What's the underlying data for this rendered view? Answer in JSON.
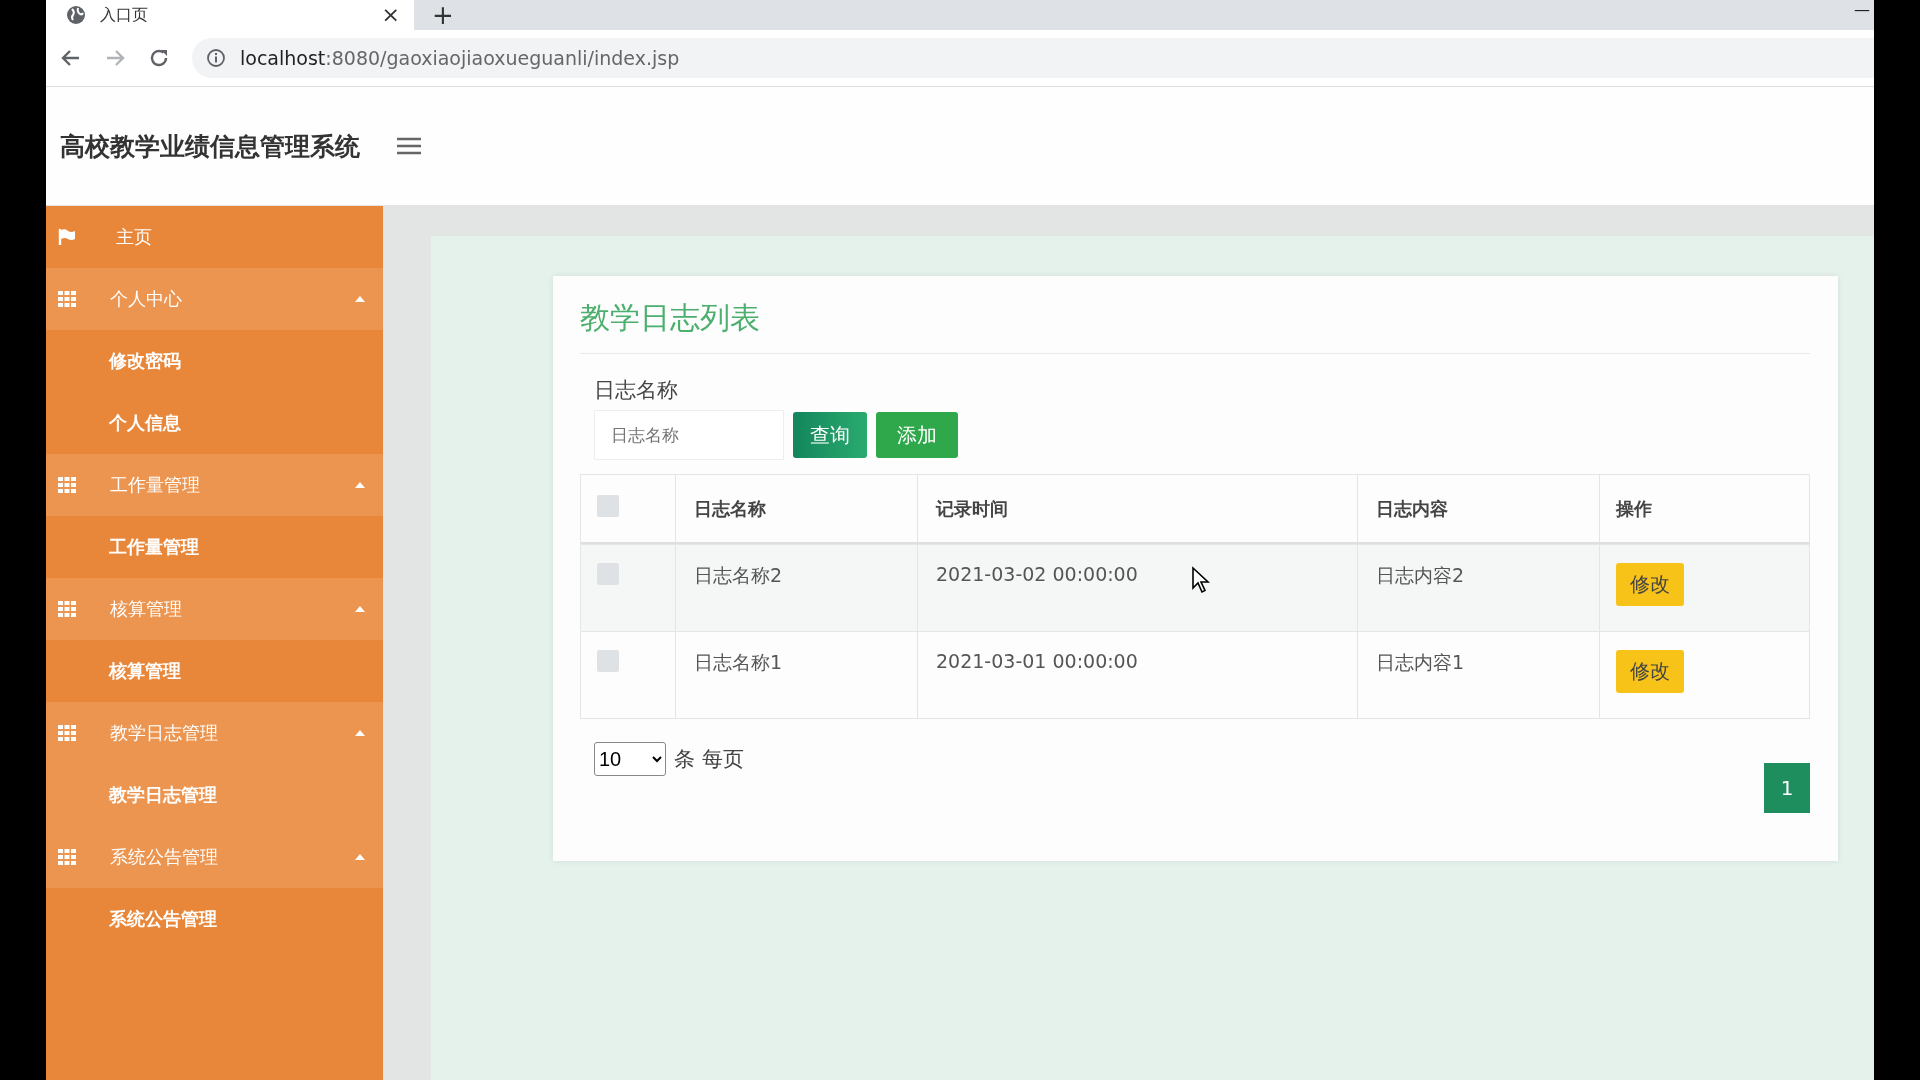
{
  "browser": {
    "tab_title": "入口页",
    "tab_close": "×",
    "new_tab": "+",
    "minimize": "—",
    "url_host": "localhost",
    "url_rest": ":8080/gaoxiaojiaoxueguanli/index.jsp"
  },
  "header": {
    "title": "高校教学业绩信息管理系统"
  },
  "sidebar": {
    "items": [
      {
        "kind": "link",
        "label": "主页",
        "selected": false
      },
      {
        "kind": "group",
        "label": "个人中心",
        "expanded": true,
        "children": [
          {
            "label": "修改密码",
            "selected": false
          },
          {
            "label": "个人信息",
            "selected": false
          }
        ]
      },
      {
        "kind": "group",
        "label": "工作量管理",
        "expanded": true,
        "children": [
          {
            "label": "工作量管理",
            "selected": false
          }
        ]
      },
      {
        "kind": "group",
        "label": "核算管理",
        "expanded": true,
        "children": [
          {
            "label": "核算管理",
            "selected": false
          }
        ]
      },
      {
        "kind": "group",
        "label": "教学日志管理",
        "expanded": true,
        "children": [
          {
            "label": "教学日志管理",
            "selected": true
          }
        ]
      },
      {
        "kind": "group",
        "label": "系统公告管理",
        "expanded": true,
        "children": [
          {
            "label": "系统公告管理",
            "selected": false
          }
        ]
      }
    ]
  },
  "card": {
    "title": "教学日志列表",
    "search_label": "日志名称",
    "search": {
      "placeholder": "日志名称"
    },
    "buttons": [
      "查询",
      "添加"
    ]
  },
  "table": {
    "select_all_checked": false,
    "columns": [
      "日志名称",
      "记录时间",
      "日志内容",
      "操作"
    ],
    "rows": [
      {
        "checked": false,
        "cells": [
          "日志名称2",
          "2021-03-02 00:00:00",
          "日志内容2"
        ],
        "action": "修改"
      },
      {
        "checked": false,
        "cells": [
          "日志名称1",
          "2021-03-01 00:00:00",
          "日志内容1"
        ],
        "action": "修改"
      }
    ]
  },
  "pagination": {
    "page_size": "10",
    "page_size_label": "条 每页",
    "pages": [
      {
        "label": "1",
        "selected": true
      }
    ]
  }
}
